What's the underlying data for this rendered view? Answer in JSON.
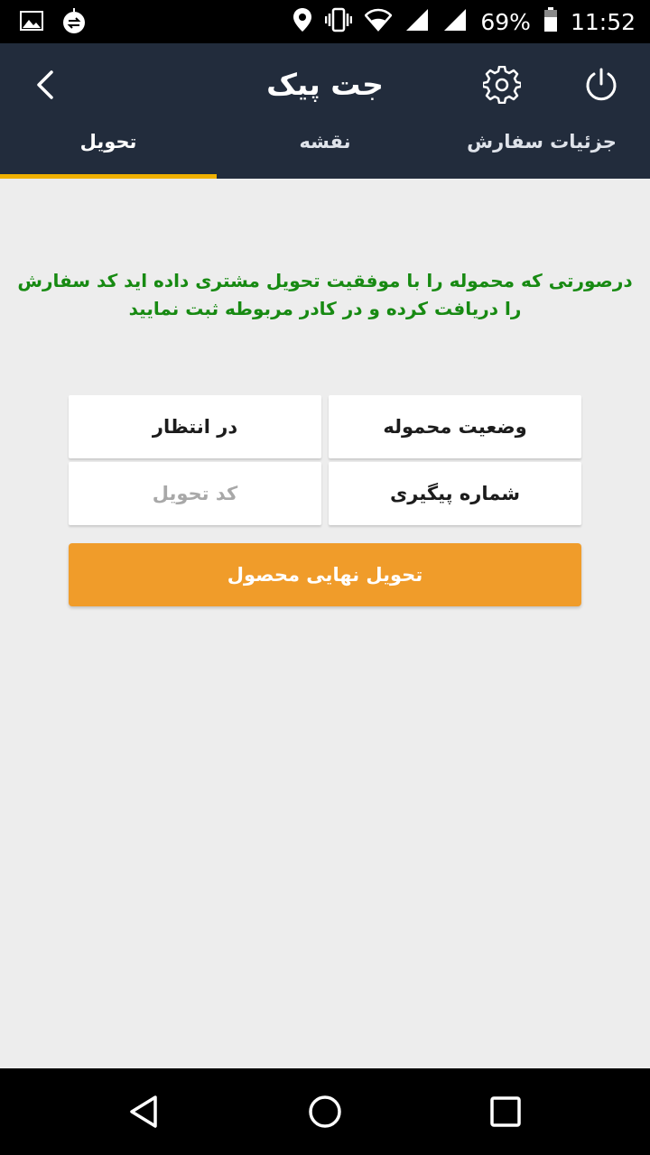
{
  "status_bar": {
    "battery": "69%",
    "time": "11:52"
  },
  "app_bar": {
    "title": "جت پیک",
    "icons": {
      "back": "chevron-left-icon",
      "settings": "gear-icon",
      "power": "power-icon"
    }
  },
  "tabs": [
    {
      "label": "تحویل",
      "active": true
    },
    {
      "label": "نقشه",
      "active": false
    },
    {
      "label": "جزئیات سفارش",
      "active": false
    }
  ],
  "instruction": "درصورتی که محموله را با موفقیت تحویل مشتری داده اید کد سفارش را دریافت کرده و در کادر مربوطه ثبت نمایید",
  "form": {
    "status_label": "وضعیت محموله",
    "status_value": "در انتظار",
    "tracking_label": "شماره پیگیری",
    "delivery_code_placeholder": "کد تحویل",
    "delivery_code_value": ""
  },
  "deliver_button": "تحویل نهایی محصول",
  "colors": {
    "app_bar": "#222c3c",
    "tab_indicator": "#f0b000",
    "instruction_text": "#178a12",
    "button": "#f09c2a",
    "background": "#ededed"
  }
}
